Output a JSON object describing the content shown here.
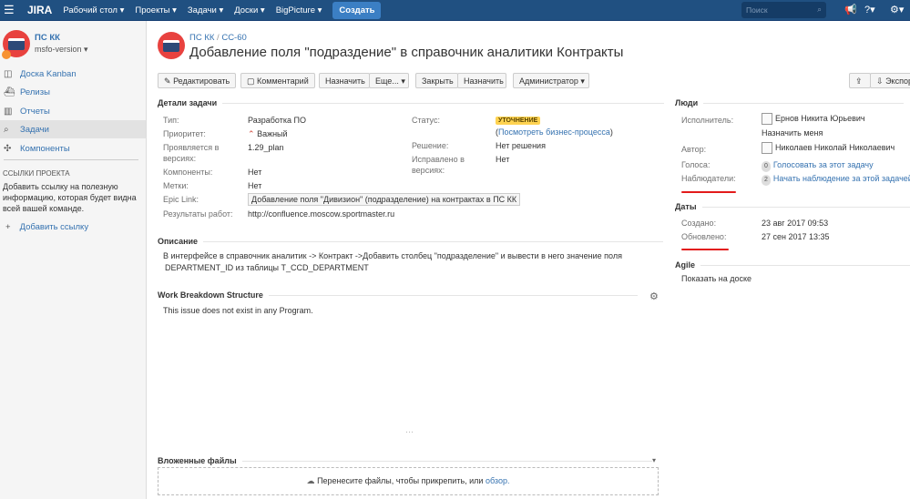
{
  "header": {
    "logo": "JIRA",
    "nav": [
      "Рабочий стол ▾",
      "Проекты ▾",
      "Задачи ▾",
      "Доски ▾",
      "BigPicture ▾"
    ],
    "create": "Создать",
    "search_placeholder": "Поиск",
    "help": "?▾",
    "settings": "⚙▾"
  },
  "sidebar": {
    "project": "ПС КК",
    "version": "msfo-version ▾",
    "items": [
      {
        "label": "Доска Kanban",
        "icon": "board-icon"
      },
      {
        "label": "Релизы",
        "icon": "ship-icon"
      },
      {
        "label": "Отчеты",
        "icon": "reports-icon"
      },
      {
        "label": "Задачи",
        "icon": "issues-icon"
      },
      {
        "label": "Компоненты",
        "icon": "puzzle-icon"
      }
    ],
    "links_heading": "ССЫЛКИ ПРОЕКТА",
    "links_help": "Добавить ссылку на полезную информацию, которая будет видна всей вашей команде.",
    "add_link": "Добавить ссылку"
  },
  "issue": {
    "breadcrumb_project": "ПС КК",
    "breadcrumb_sep": "/",
    "key": "CC-60",
    "title": "Добавление поля \"подраздение\" в справочник аналитики Контракты"
  },
  "toolbar": {
    "edit": "Редактировать",
    "comment": "Комментарий",
    "assign": "Назначить",
    "more": "Еще... ▾",
    "close": "Закрыть",
    "assign2": "Назначить",
    "admin": "Администратор ▾",
    "export": "Экспор"
  },
  "details": {
    "heading": "Детали задачи",
    "type_label": "Тип:",
    "type": "Разработка ПО",
    "priority_label": "Приоритет:",
    "priority": "Важный",
    "affects_label": "Проявляется в версиях:",
    "affects": "1.29_plan",
    "components_label": "Компоненты:",
    "components": "Нет",
    "labels_label": "Метки:",
    "labels": "Нет",
    "epic_label": "Epic Link:",
    "epic": "Добавление поля \"Дивизион\" (подразделение) на контрактах в ПС КК",
    "results_label": "Результаты работ:",
    "results": "http://confluence.moscow.sportmaster.ru",
    "status_label": "Статус:",
    "status": "УТОЧНЕНИЕ",
    "workflow_open": "(",
    "workflow": "Посмотреть бизнес-процесса",
    "workflow_close": ")",
    "resolution_label": "Решение:",
    "resolution": "Нет решения",
    "fix_label": "Исправлено в версиях:",
    "fix": "Нет"
  },
  "description": {
    "heading": "Описание",
    "text1": "В интерфейсе в справочник аналитик -> Контракт ->Добавить столбец \"подразделение\" и вывести в него значение поля",
    "text2": "DEPARTMENT_ID из таблицы T_CCD_DEPARTMENT"
  },
  "wbs": {
    "heading": "Work Breakdown Structure",
    "text": "This issue does not exist in any Program."
  },
  "attachments": {
    "heading": "Вложенные файлы",
    "drop": "Перенесите файлы, чтобы прикрепить, или ",
    "browse": "обзор."
  },
  "people": {
    "heading": "Люди",
    "assignee_label": "Исполнитель:",
    "assignee": "Ернов Никита Юрьевич",
    "assign_me": "Назначить меня",
    "reporter_label": "Автор:",
    "reporter": "Николаев Николай Николаевич",
    "votes_label": "Голоса:",
    "votes": "0",
    "vote_link": "Голосовать за этот задачу",
    "watchers_label": "Наблюдатели:",
    "watchers": "2",
    "watch_link": "Начать наблюдение за этой задачей"
  },
  "dates": {
    "heading": "Даты",
    "created_label": "Создано:",
    "created": "23 авг 2017 09:53",
    "updated_label": "Обновлено:",
    "updated": "27 сен 2017 13:35"
  },
  "agile": {
    "heading": "Agile",
    "link": "Показать на доске"
  },
  "colors": {
    "header": "#205081",
    "link": "#3572b0",
    "status": "#ffd351",
    "annotation": "#e31b1b"
  }
}
